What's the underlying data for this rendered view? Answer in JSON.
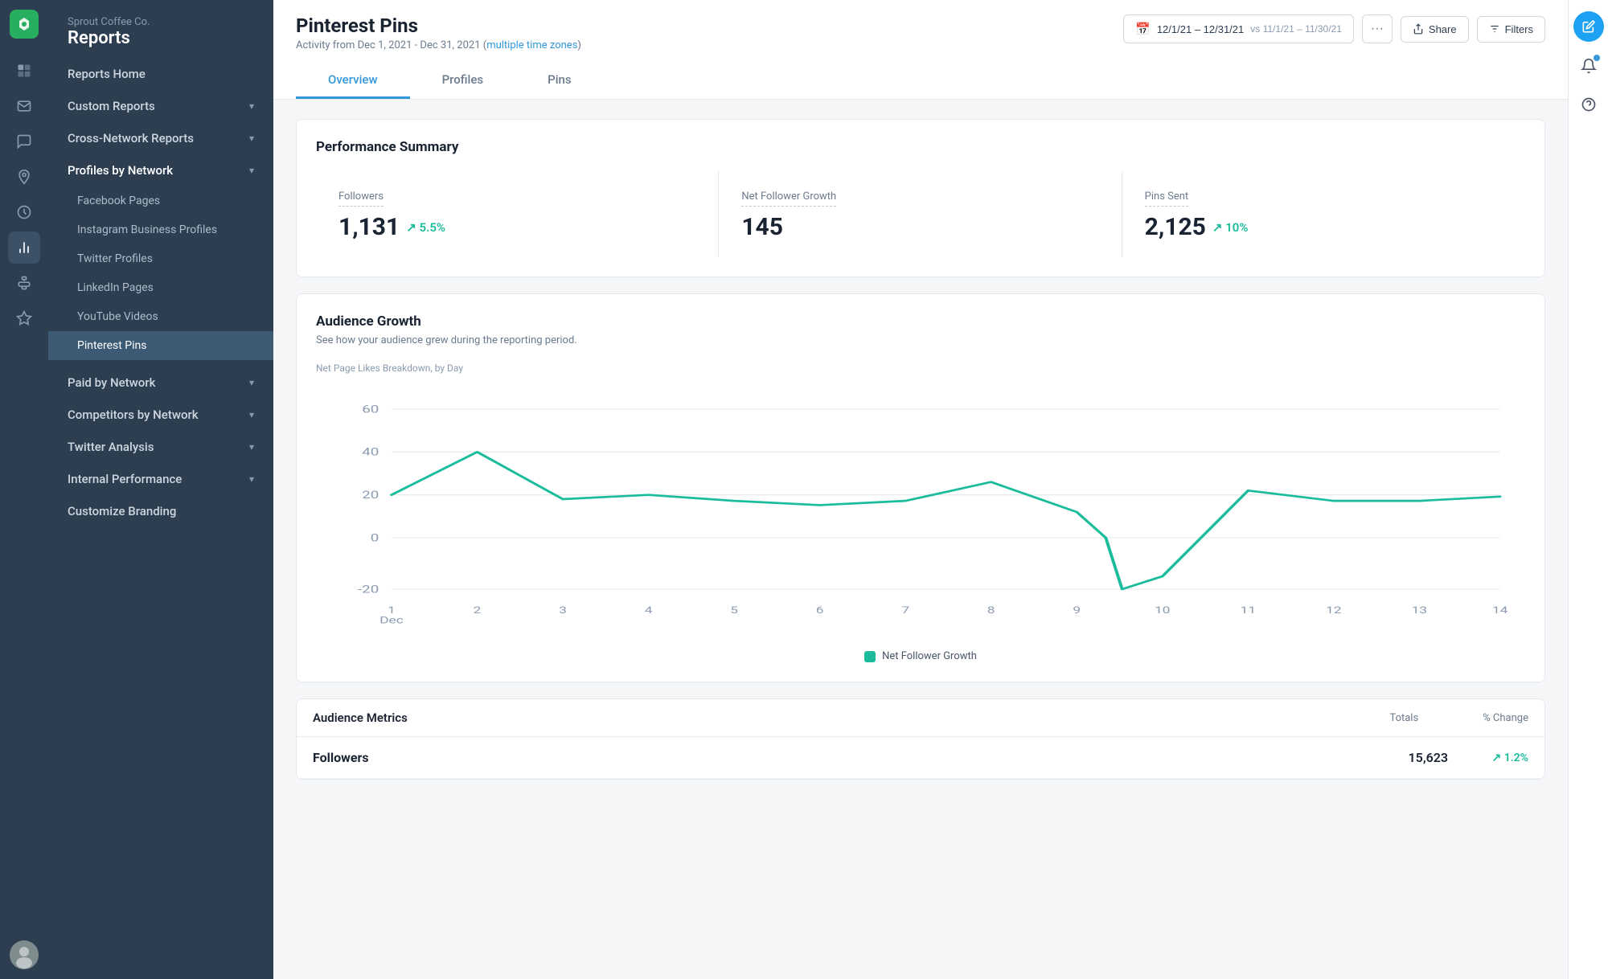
{
  "app": {
    "company": "Sprout Coffee Co.",
    "section": "Reports"
  },
  "sidebar": {
    "items": [
      {
        "id": "reports-home",
        "label": "Reports Home",
        "active": false,
        "expandable": false
      },
      {
        "id": "custom-reports",
        "label": "Custom Reports",
        "active": false,
        "expandable": true
      },
      {
        "id": "cross-network",
        "label": "Cross-Network Reports",
        "active": false,
        "expandable": true
      },
      {
        "id": "profiles-by-network",
        "label": "Profiles by Network",
        "active": true,
        "expandable": true
      }
    ],
    "sub_items": [
      {
        "id": "facebook-pages",
        "label": "Facebook Pages",
        "active": false
      },
      {
        "id": "instagram-profiles",
        "label": "Instagram Business Profiles",
        "active": false
      },
      {
        "id": "twitter-profiles",
        "label": "Twitter Profiles",
        "active": false
      },
      {
        "id": "linkedin-pages",
        "label": "LinkedIn Pages",
        "active": false
      },
      {
        "id": "youtube-videos",
        "label": "YouTube Videos",
        "active": false
      },
      {
        "id": "pinterest-pins",
        "label": "Pinterest Pins",
        "active": true
      }
    ],
    "bottom_items": [
      {
        "id": "paid-by-network",
        "label": "Paid by Network",
        "expandable": true
      },
      {
        "id": "competitors-by-network",
        "label": "Competitors by Network",
        "expandable": true
      },
      {
        "id": "twitter-analysis",
        "label": "Twitter Analysis",
        "expandable": true
      },
      {
        "id": "internal-performance",
        "label": "Internal Performance",
        "expandable": true
      },
      {
        "id": "customize-branding",
        "label": "Customize Branding",
        "expandable": false
      }
    ]
  },
  "page": {
    "title": "Pinterest Pins",
    "subtitle": "Activity from Dec 1, 2021 - Dec 31, 2021",
    "timezone_label": "multiple time zones",
    "date_range": "12/1/21 – 12/31/21",
    "compare_range": "vs 11/1/21 – 11/30/21",
    "tabs": [
      {
        "id": "overview",
        "label": "Overview",
        "active": true
      },
      {
        "id": "profiles",
        "label": "Profiles",
        "active": false
      },
      {
        "id": "pins",
        "label": "Pins",
        "active": false
      }
    ]
  },
  "performance_summary": {
    "title": "Performance Summary",
    "metrics": [
      {
        "id": "followers",
        "label": "Followers",
        "value": "1,131",
        "trend": "↗ 5.5%",
        "has_trend": true
      },
      {
        "id": "net-follower-growth",
        "label": "Net Follower Growth",
        "value": "145",
        "trend": "",
        "has_trend": false
      },
      {
        "id": "pins-sent",
        "label": "Pins Sent",
        "value": "2,125",
        "trend": "↗ 10%",
        "has_trend": true
      }
    ]
  },
  "audience_growth": {
    "title": "Audience Growth",
    "subtitle": "See how your audience grew during the reporting period.",
    "chart_label": "Net Page Likes Breakdown, by Day",
    "legend_label": "Net Follower Growth",
    "y_axis": [
      "60",
      "40",
      "20",
      "0",
      "-20"
    ],
    "x_axis": [
      "1\nDec",
      "2",
      "3",
      "4",
      "5",
      "6",
      "7",
      "8",
      "9",
      "10",
      "11",
      "12",
      "13",
      "14"
    ],
    "chart_color": "#1abc9c"
  },
  "audience_metrics": {
    "title": "Audience Metrics",
    "col_totals": "Totals",
    "col_change": "% Change",
    "rows": [
      {
        "label": "Followers",
        "total": "15,623",
        "change": "↗ 1.2%"
      }
    ]
  },
  "buttons": {
    "share": "Share",
    "filters": "Filters",
    "more": "···"
  },
  "icons": {
    "calendar": "📅",
    "share": "↑",
    "filter": "⚙",
    "edit": "✏",
    "bell": "🔔",
    "help": "?"
  }
}
